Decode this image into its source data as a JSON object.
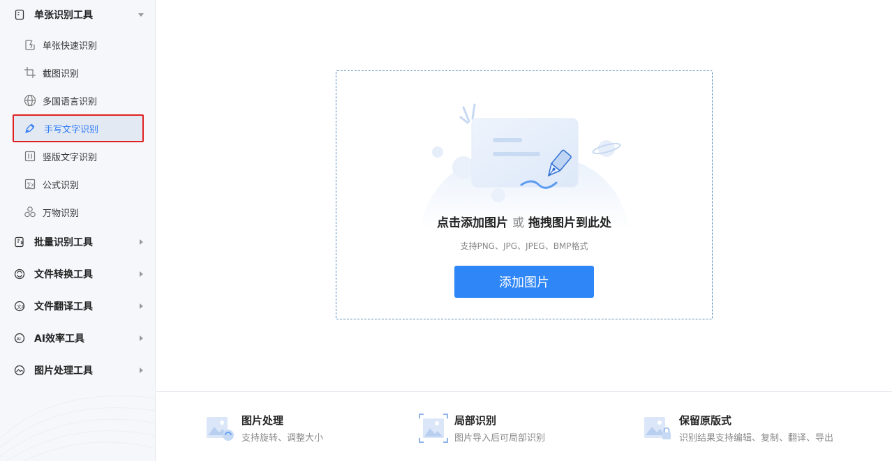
{
  "sidebar": {
    "groups": [
      {
        "label": "单张识别工具",
        "icon": "single-doc-icon",
        "expanded": true
      },
      {
        "label": "批量识别工具",
        "icon": "batch-doc-icon",
        "expanded": false
      },
      {
        "label": "文件转换工具",
        "icon": "convert-icon",
        "expanded": false
      },
      {
        "label": "文件翻译工具",
        "icon": "translate-icon",
        "expanded": false
      },
      {
        "label": "AI效率工具",
        "icon": "ai-icon",
        "expanded": false
      },
      {
        "label": "图片处理工具",
        "icon": "image-process-icon",
        "expanded": false
      }
    ],
    "items": [
      {
        "label": "单张快速识别",
        "icon": "quick-scan-icon"
      },
      {
        "label": "截图识别",
        "icon": "crop-icon"
      },
      {
        "label": "多国语言识别",
        "icon": "globe-icon"
      },
      {
        "label": "手写文字识别",
        "icon": "pen-icon",
        "active": true
      },
      {
        "label": "竖版文字识别",
        "icon": "vertical-text-icon"
      },
      {
        "label": "公式识别",
        "icon": "formula-icon"
      },
      {
        "label": "万物识别",
        "icon": "objects-icon"
      }
    ]
  },
  "dropzone": {
    "title_click": "点击添加图片",
    "title_or": "或",
    "title_drag": "拖拽图片到此处",
    "hint": "支持PNG、JPG、JPEG、BMP格式",
    "button_label": "添加图片"
  },
  "features": [
    {
      "title": "图片处理",
      "desc": "支持旋转、调整大小",
      "icon": "image-process-feature-icon"
    },
    {
      "title": "局部识别",
      "desc": "图片导入后可局部识别",
      "icon": "partial-recognize-icon"
    },
    {
      "title": "保留原版式",
      "desc": "识别结果支持编辑、复制、翻译、导出",
      "icon": "keep-layout-icon"
    }
  ],
  "colors": {
    "accent": "#2f86f6",
    "active_text": "#2f7cf6",
    "highlight_border": "#e02020",
    "sidebar_bg": "#f5f7fa"
  }
}
